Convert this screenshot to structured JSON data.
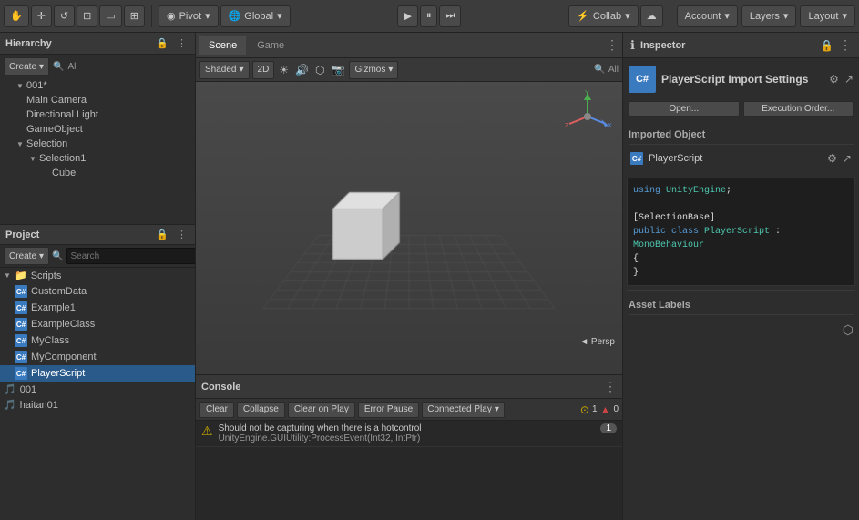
{
  "toolbar": {
    "pivot_label": "Pivot",
    "global_label": "Global",
    "collab_label": "Collab",
    "account_label": "Account",
    "layers_label": "Layers",
    "layout_label": "Layout",
    "cloud_icon": "☁"
  },
  "hierarchy": {
    "title": "Hierarchy",
    "create_label": "Create",
    "all_label": "All",
    "root_item": "001*",
    "items": [
      {
        "label": "Main Camera",
        "indent": 1,
        "type": "camera"
      },
      {
        "label": "Directional Light",
        "indent": 1,
        "type": "light"
      },
      {
        "label": "GameObject",
        "indent": 1,
        "type": "object"
      },
      {
        "label": "Selection",
        "indent": 1,
        "type": "folder",
        "open": true
      },
      {
        "label": "Selection1",
        "indent": 2,
        "type": "folder",
        "open": true
      },
      {
        "label": "Cube",
        "indent": 3,
        "type": "cube"
      }
    ]
  },
  "project": {
    "title": "Project",
    "create_label": "Create",
    "search_placeholder": "Search",
    "scripts_label": "Scripts",
    "files": [
      {
        "label": "CustomData",
        "type": "cs",
        "indent": 1
      },
      {
        "label": "Example1",
        "type": "cs",
        "indent": 1
      },
      {
        "label": "ExampleClass",
        "type": "cs",
        "indent": 1
      },
      {
        "label": "MyClass",
        "type": "cs",
        "indent": 1
      },
      {
        "label": "MyComponent",
        "type": "cs",
        "indent": 1
      },
      {
        "label": "PlayerScript",
        "type": "cs",
        "indent": 1,
        "selected": true
      }
    ],
    "extra_items": [
      {
        "label": "001",
        "type": "folder"
      },
      {
        "label": "haitan01",
        "type": "folder"
      }
    ]
  },
  "scene": {
    "tab_scene": "Scene",
    "tab_game": "Game",
    "shaded_label": "Shaded",
    "twod_label": "2D",
    "gizmos_label": "Gizmos",
    "all_label": "All",
    "persp_label": "◄ Persp"
  },
  "console": {
    "title": "Console",
    "clear_label": "Clear",
    "collapse_label": "Collapse",
    "clear_on_play_label": "Clear on Play",
    "error_pause_label": "Error Pause",
    "connected_play_label": "Connected Play",
    "warn_count": "1",
    "err_count": "0",
    "badge_warn": "▲ 0",
    "badge_err_label": "0",
    "warn_icon": "⚠",
    "message_line1": "Should not be capturing when there is a hotcontrol",
    "message_line2": "UnityEngine.GUIUtility:ProcessEvent(Int32, IntPtr)",
    "count_badge": "1"
  },
  "inspector": {
    "title": "Inspector",
    "import_settings_title": "PlayerScript Import Settings",
    "open_label": "Open...",
    "execution_order_label": "Execution Order...",
    "imported_object_title": "Imported Object",
    "script_label": "PlayerScript",
    "asset_labels_title": "Asset Labels",
    "code": {
      "line1": "using UnityEngine;",
      "line2": "",
      "line3": "[SelectionBase]",
      "line4": "public class PlayerScript : MonoBehaviour",
      "line5": "{",
      "line6": "}"
    }
  }
}
